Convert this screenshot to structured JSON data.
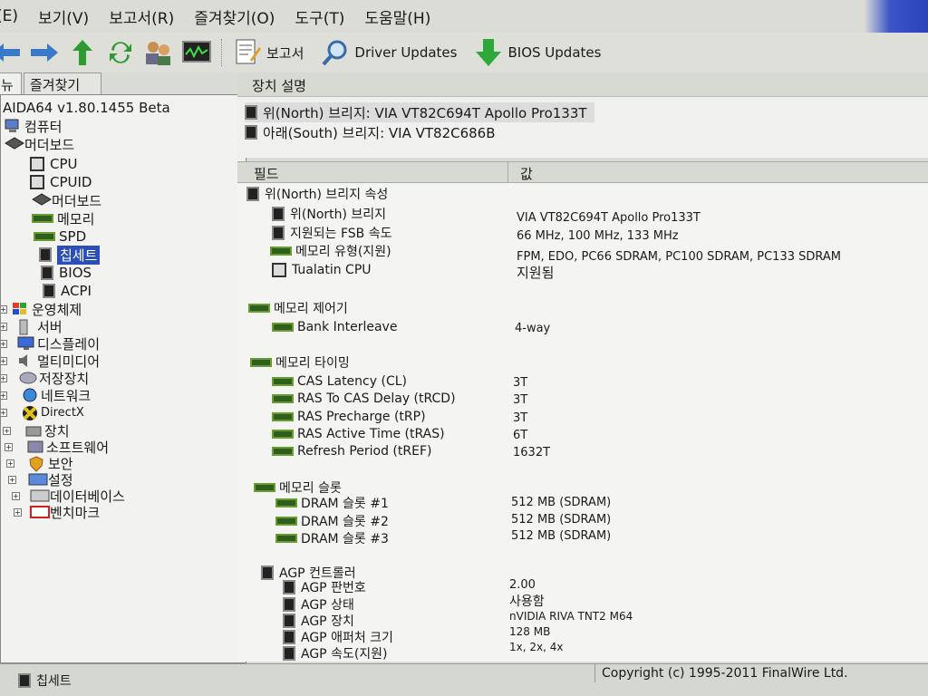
{
  "menu": {
    "items": [
      "(E)",
      "보기(V)",
      "보고서(R)",
      "즐겨찾기(O)",
      "도구(T)",
      "도움말(H)"
    ]
  },
  "toolbar": {
    "report_label": "보고서",
    "driver_updates_label": "Driver Updates",
    "bios_updates_label": "BIOS Updates"
  },
  "left_tabs": {
    "tab0": "뉴",
    "tab1": "즐겨찾기"
  },
  "tree": {
    "root": "AIDA64 v1.80.1455 Beta",
    "computer": "컴퓨터",
    "motherboard": "머더보드",
    "mb_children": [
      "CPU",
      "CPUID",
      "머더보드",
      "메모리",
      "SPD",
      "칩세트",
      "BIOS",
      "ACPI"
    ],
    "other": [
      "운영체제",
      "서버",
      "디스플레이",
      "멀티미디어",
      "저장장치",
      "네트워크",
      "DirectX",
      "장치",
      "소프트웨어",
      "보안",
      "설정",
      "데이터베이스",
      "벤치마크"
    ]
  },
  "right": {
    "header": "장치 설명",
    "devices": [
      "위(North) 브리지: VIA VT82C694T Apollo Pro133T",
      "아래(South) 브리지: VIA VT82C686B"
    ],
    "col_field": "필드",
    "col_value": "값"
  },
  "sections": [
    {
      "title": "위(North) 브리지 속성",
      "rows": [
        {
          "field": "위(North) 브리지",
          "value": "VIA VT82C694T Apollo Pro133T"
        },
        {
          "field": "지원되는 FSB 속도",
          "value": "66 MHz, 100 MHz, 133 MHz"
        },
        {
          "field": "메모리 유형(지원)",
          "value": "FPM, EDO, PC66 SDRAM, PC100 SDRAM, PC133 SDRAM"
        },
        {
          "field": "Tualatin CPU",
          "value": "지원됨"
        }
      ]
    },
    {
      "title": "메모리 제어기",
      "rows": [
        {
          "field": "Bank Interleave",
          "value": "4-way"
        }
      ]
    },
    {
      "title": "메모리 타이밍",
      "rows": [
        {
          "field": "CAS Latency (CL)",
          "value": "3T"
        },
        {
          "field": "RAS To CAS Delay (tRCD)",
          "value": "3T"
        },
        {
          "field": "RAS Precharge (tRP)",
          "value": "3T"
        },
        {
          "field": "RAS Active Time (tRAS)",
          "value": "6T"
        },
        {
          "field": "Refresh Period (tREF)",
          "value": "1632T"
        }
      ]
    },
    {
      "title": "메모리 슬롯",
      "rows": [
        {
          "field": "DRAM 슬롯 #1",
          "value": "512 MB  (SDRAM)"
        },
        {
          "field": "DRAM 슬롯 #2",
          "value": "512 MB  (SDRAM)"
        },
        {
          "field": "DRAM 슬롯 #3",
          "value": "512 MB  (SDRAM)"
        }
      ]
    },
    {
      "title": "AGP 컨트롤러",
      "rows": [
        {
          "field": "AGP 판번호",
          "value": "2.00"
        },
        {
          "field": "AGP 상태",
          "value": "사용함"
        },
        {
          "field": "AGP 장치",
          "value": "nVIDIA RIVA TNT2 M64"
        },
        {
          "field": "AGP 애퍼처 크기",
          "value": "128 MB"
        },
        {
          "field": "AGP 속도(지원)",
          "value": "1x, 2x, 4x"
        }
      ]
    }
  ],
  "status": {
    "left": "칩세트",
    "right": "Copyright (c) 1995-2011 FinalWire Ltd."
  }
}
